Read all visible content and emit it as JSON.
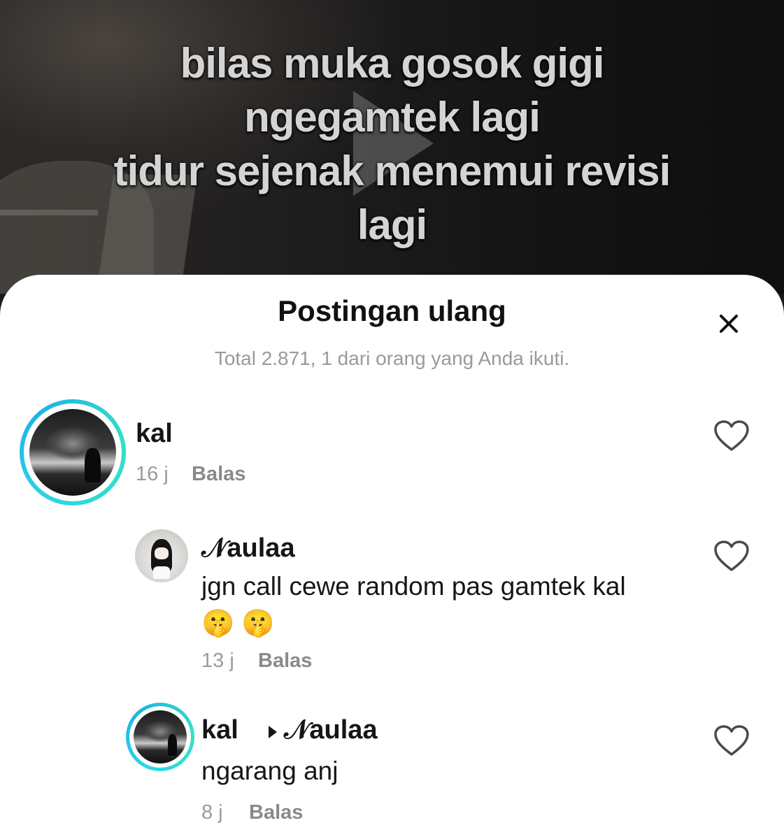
{
  "video": {
    "caption_lines": [
      "bilas muka gosok gigi",
      "ngegamtek lagi",
      "tidur sejenak menemui revisi",
      "lagi"
    ]
  },
  "sheet": {
    "title": "Postingan ulang",
    "subtitle": "Total 2.871, 1 dari orang yang Anda ikuti."
  },
  "comments": [
    {
      "username": "kal",
      "time": "16 j",
      "reply_label": "Balas"
    },
    {
      "username": "𝒩aulaa",
      "text_line1": "jgn call cewe random pas gamtek kal",
      "text_line2": "🤫🤫",
      "time": "13 j",
      "reply_label": "Balas"
    },
    {
      "username": "kal",
      "reply_to": "𝒩aulaa",
      "text_line1": "ngarang anj",
      "time": "8 j",
      "reply_label": "Balas"
    }
  ],
  "icons": {
    "close": "close-icon",
    "heart": "heart-outline-icon",
    "play": "play-icon"
  },
  "colors": {
    "story_ring": "#2dd6e6",
    "muted_text": "#9a9a9a",
    "primary_text": "#161616"
  }
}
